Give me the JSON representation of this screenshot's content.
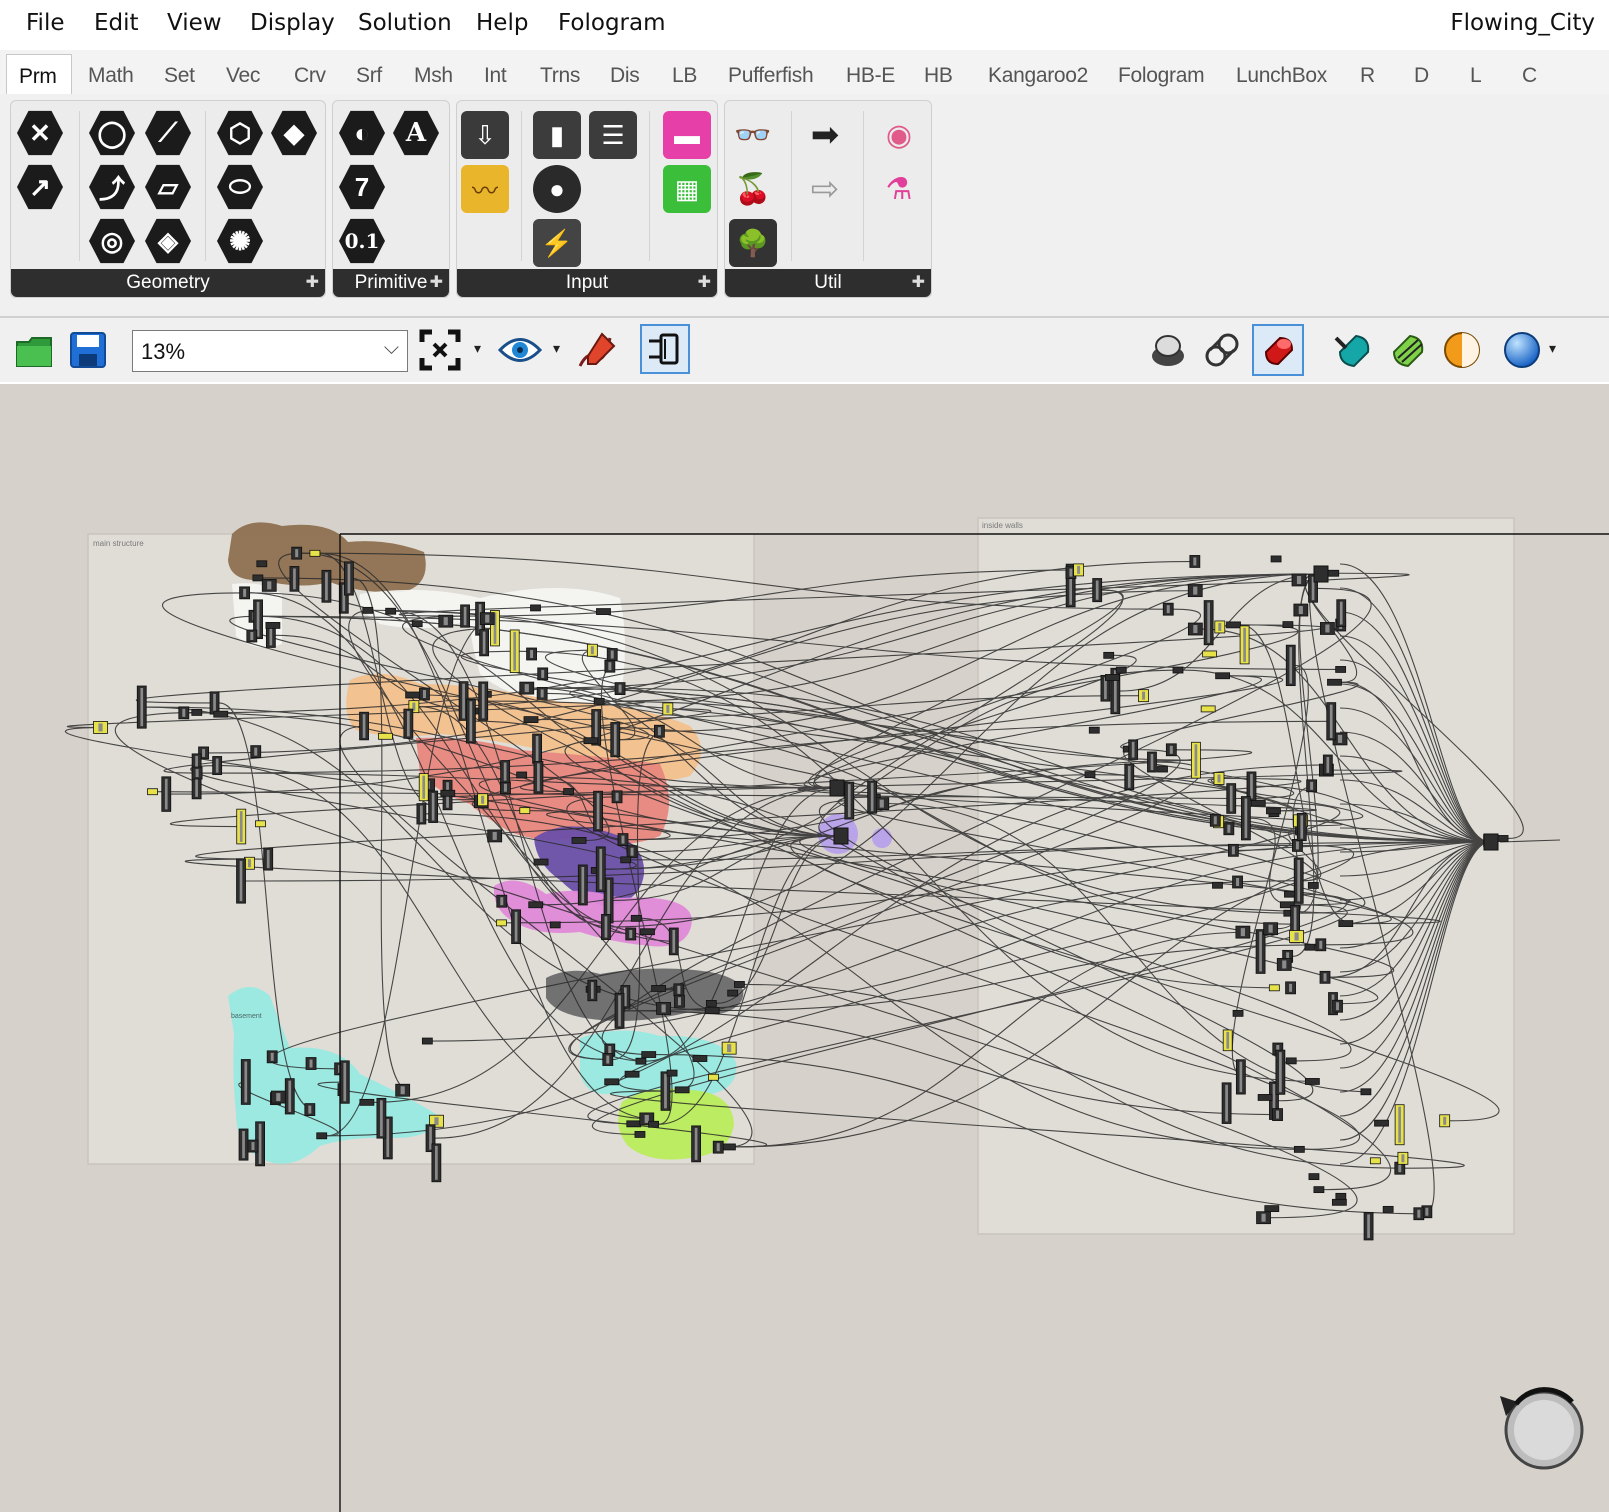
{
  "menu": {
    "items": [
      "File",
      "Edit",
      "View",
      "Display",
      "Solution",
      "Help",
      "Fologram"
    ],
    "document_title": "Flowing_City"
  },
  "tabs": {
    "active": "Prm",
    "items": [
      "Prm",
      "Math",
      "Set",
      "Vec",
      "Crv",
      "Srf",
      "Msh",
      "Int",
      "Trns",
      "Dis",
      "LB",
      "Pufferfish",
      "HB-E",
      "HB",
      "Kangaroo2",
      "Fologram",
      "LunchBox",
      "R",
      "D",
      "L",
      "C"
    ]
  },
  "ribbon": {
    "panels": {
      "geometry": "Geometry",
      "primitive": "Primitive",
      "input": "Input",
      "util": "Util"
    },
    "primitive_labels": {
      "text": "A",
      "integer": "7",
      "number": "0.1"
    }
  },
  "toolbar": {
    "zoom": "13%",
    "icons": [
      "open-file-icon",
      "save-icon",
      "zoom-extents-icon",
      "preview-eye-icon",
      "sketch-pen-icon",
      "pin-component-icon",
      "preview-off-icon",
      "preview-wireframe-icon",
      "preview-shaded-icon",
      "preview-selected-icon",
      "display-mesh-icon",
      "material-icon",
      "sphere-icon"
    ]
  },
  "canvas": {
    "groups": {
      "main": "main structure",
      "inside": "inside walls",
      "basement": "basement"
    },
    "group_colors": {
      "brown": "#8b6a4a",
      "white": "#f4f4f2",
      "orange": "#f2c08d",
      "red": "#e8877e",
      "purple": "#6a4fa8",
      "pink": "#e089d8",
      "dark": "#6c6a6b",
      "cyan": "#98e9e1",
      "lime": "#b9ec5b",
      "lavender": "#b7a0ea"
    }
  }
}
